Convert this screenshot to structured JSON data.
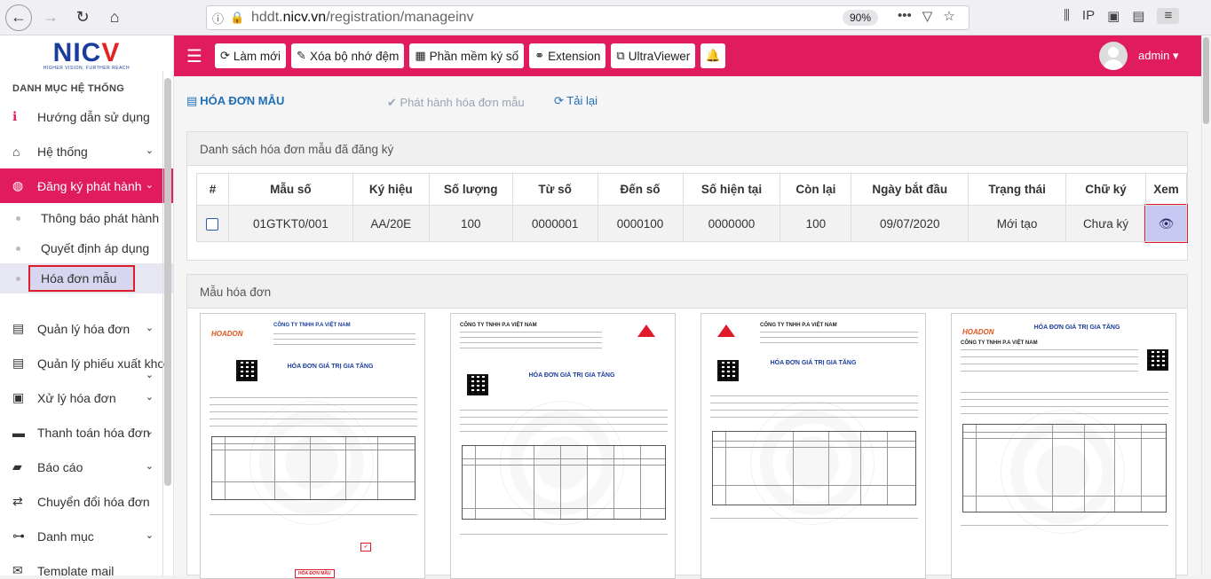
{
  "browser": {
    "url_host": "hddt.",
    "url_domain": "nicv.vn",
    "url_path": "/registration/manageinv",
    "zoom": "90%"
  },
  "logo": {
    "brand_main": "NIC",
    "brand_accent": "V",
    "tagline": "HIGHER VISION, FURTHER REACH"
  },
  "sidebar": {
    "title": "DANH MỤC HỆ THỐNG",
    "items": [
      {
        "label": "Hướng dẫn sử dụng"
      },
      {
        "label": "Hệ thống"
      },
      {
        "label": "Đăng ký phát hành"
      },
      {
        "label": "Quản lý hóa đơn"
      },
      {
        "label": "Quản lý phiếu xuất kho"
      },
      {
        "label": "Xử lý hóa đơn"
      },
      {
        "label": "Thanh toán hóa đơn"
      },
      {
        "label": "Báo cáo"
      },
      {
        "label": "Chuyển đổi hóa đơn"
      },
      {
        "label": "Danh mục"
      },
      {
        "label": "Template mail"
      }
    ],
    "subitems": [
      {
        "label": "Thông báo phát hành"
      },
      {
        "label": "Quyết định áp dụng"
      },
      {
        "label": "Hóa đơn mẫu"
      }
    ]
  },
  "toolbar": {
    "refresh": "Làm mới",
    "clear_cache": "Xóa bộ nhớ đệm",
    "sign_software": "Phần mềm ký số",
    "extension": "Extension",
    "ultraviewer": "UltraViewer"
  },
  "user": {
    "name": "admin"
  },
  "page": {
    "title": "HÓA ĐƠN MẪU",
    "action_issue": "Phát hành hóa đơn mẫu",
    "action_reload": "Tải lại"
  },
  "registered": {
    "panel_title": "Danh sách hóa đơn mẫu đã đăng ký",
    "columns": [
      "#",
      "Mẫu số",
      "Ký hiệu",
      "Số lượng",
      "Từ số",
      "Đến số",
      "Số hiện tại",
      "Còn lại",
      "Ngày bắt đầu",
      "Trạng thái",
      "Chữ ký",
      "Xem"
    ],
    "rows": [
      {
        "mau_so": "01GTKT0/001",
        "ky_hieu": "AA/20E",
        "so_luong": "100",
        "tu_so": "0000001",
        "den_so": "0000100",
        "so_hien_tai": "0000000",
        "con_lai": "100",
        "ngay_bat_dau": "09/07/2020",
        "trang_thai": "Mới tạo",
        "chu_ky": "Chưa ký"
      }
    ]
  },
  "templates": {
    "panel_title": "Mẫu hóa đơn",
    "items": [
      {
        "company": "CÔNG TY TNHH P.A VIỆT NAM",
        "title": "HÓA ĐƠN GIÁ TRỊ GIA TĂNG",
        "stamp": "HÓA ĐƠN MẪU"
      },
      {
        "company": "CÔNG TY TNHH P.A VIỆT NAM",
        "title": "HÓA ĐƠN GIÁ TRỊ GIA TĂNG"
      },
      {
        "company": "CÔNG TY TNHH P.A VIỆT NAM",
        "title": "HÓA ĐƠN GIÁ TRỊ GIA TĂNG"
      },
      {
        "company": "CÔNG TY TNHH P.A VIỆT NAM",
        "title": "HÓA ĐƠN GIÁ TRỊ GIA TĂNG"
      }
    ]
  },
  "colors": {
    "accent": "#e01c5e",
    "link": "#1e6fb6",
    "highlight": "#e01c2a"
  }
}
